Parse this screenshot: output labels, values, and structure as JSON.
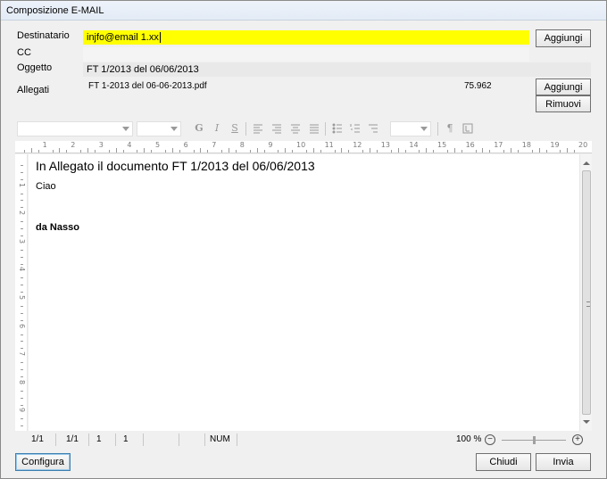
{
  "window": {
    "title": "Composizione E-MAIL"
  },
  "fields": {
    "destinatario": {
      "label": "Destinatario",
      "value": "injfo@email 1.xx"
    },
    "cc": {
      "label": "CC",
      "value": ""
    },
    "oggetto": {
      "label": "Oggetto",
      "value": "FT 1/2013 del 06/06/2013"
    },
    "allegati": {
      "label": "Allegati",
      "file": "FT 1-2013 del 06-06-2013.pdf",
      "size": "75.962"
    }
  },
  "buttons": {
    "aggiungi_dest": "Aggiungi",
    "aggiungi_alleg": "Aggiungi",
    "rimuovi": "Rimuovi",
    "configura": "Configura",
    "chiudi": "Chiudi",
    "invia": "Invia"
  },
  "toolbar": {
    "bold": "G",
    "italic": "I",
    "underline": "S",
    "pilcrow": "¶",
    "icons": [
      "align-left-icon",
      "align-center-icon",
      "align-right-icon",
      "justify-icon",
      "bullets-icon",
      "numbering-icon",
      "outline-icon"
    ]
  },
  "ruler": {
    "labels": [
      "1",
      "2",
      "3",
      "4",
      "5",
      "6",
      "7",
      "8",
      "9",
      "10",
      "11",
      "12",
      "13",
      "14",
      "15",
      "16",
      "17",
      "18",
      "19",
      "20"
    ]
  },
  "vruler": {
    "labels": [
      "1",
      "2",
      "3",
      "4",
      "5",
      "6",
      "7",
      "8",
      "9"
    ]
  },
  "body": {
    "line1": "In Allegato il documento FT 1/2013 del 06/06/2013",
    "line2": "Ciao",
    "line3": "da Nasso"
  },
  "status": {
    "page": "1/1",
    "section": "1/1",
    "line": "1",
    "col": "1",
    "num": "NUM",
    "zoom": "100 %",
    "zoom_level": 0.5
  },
  "colors": {
    "highlight": "#ffff00",
    "window_bg": "#f0f0f0"
  }
}
